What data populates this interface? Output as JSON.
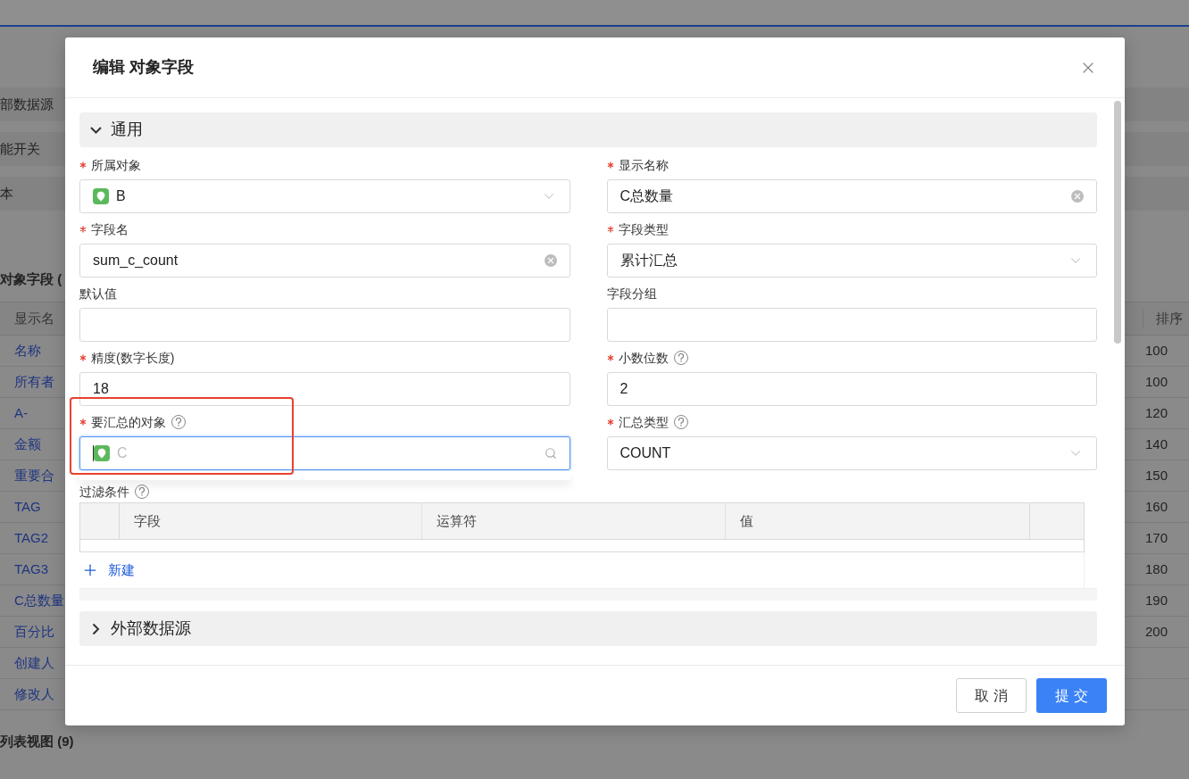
{
  "background": {
    "sections": [
      "部数据源",
      "能开关",
      "本"
    ],
    "fields_title": "对象字段 (",
    "table": {
      "columns": [
        "显示名",
        "排序"
      ],
      "rows": [
        {
          "name": "名称",
          "order": "100"
        },
        {
          "name": "所有者",
          "order": "100"
        },
        {
          "name": "A-",
          "order": "120"
        },
        {
          "name": "金额",
          "order": "140"
        },
        {
          "name": "重要合",
          "order": "150"
        },
        {
          "name": "TAG",
          "order": "160"
        },
        {
          "name": "TAG2",
          "order": "170"
        },
        {
          "name": "TAG3",
          "order": "180"
        },
        {
          "name": "C总数量",
          "order": "190"
        },
        {
          "name": "百分比",
          "order": "200"
        },
        {
          "name": "创建人"
        },
        {
          "name": "修改人"
        }
      ]
    },
    "list_title": "列表视图 (9)"
  },
  "dialog": {
    "title": "编辑 对象字段",
    "sections": [
      {
        "title": "通用",
        "expanded": true
      },
      {
        "title": "外部数据源",
        "expanded": false
      }
    ],
    "fields": [
      {
        "kind": "select",
        "label": "所属对象",
        "required": true,
        "help": false,
        "value": "B",
        "object_icon": true,
        "focused": false
      },
      {
        "kind": "text",
        "label": "显示名称",
        "required": true,
        "help": false,
        "value": "C总数量",
        "clearable": true,
        "focused": false
      },
      {
        "kind": "text",
        "label": "字段名",
        "required": true,
        "help": false,
        "value": "sum_c_count",
        "clearable": true,
        "focused": false
      },
      {
        "kind": "select",
        "label": "字段类型",
        "required": true,
        "help": false,
        "value": "累计汇总",
        "focused": false
      },
      {
        "kind": "text",
        "label": "默认值",
        "required": false,
        "help": false,
        "focused": false
      },
      {
        "kind": "text",
        "label": "字段分组",
        "required": false,
        "help": false,
        "focused": false
      },
      {
        "kind": "text",
        "label": "精度(数字长度)",
        "required": true,
        "help": false,
        "value": "18",
        "focused": false
      },
      {
        "kind": "text",
        "label": "小数位数",
        "required": true,
        "help": true,
        "value": "2",
        "focused": false
      },
      {
        "kind": "search",
        "label": "要汇总的对象",
        "required": true,
        "help": true,
        "placeholder": "C",
        "object_icon": true,
        "focused": true,
        "highlighted": true
      },
      {
        "kind": "select",
        "label": "汇总类型",
        "required": true,
        "help": true,
        "value": "COUNT",
        "focused": false
      }
    ],
    "filter": {
      "label": "过滤条件",
      "help": true,
      "columns": [
        "字段",
        "运算符",
        "值"
      ],
      "add_label": "新建"
    },
    "buttons": [
      {
        "kind": "cancel",
        "label": "取 消"
      },
      {
        "kind": "submit",
        "label": "提 交"
      }
    ]
  }
}
